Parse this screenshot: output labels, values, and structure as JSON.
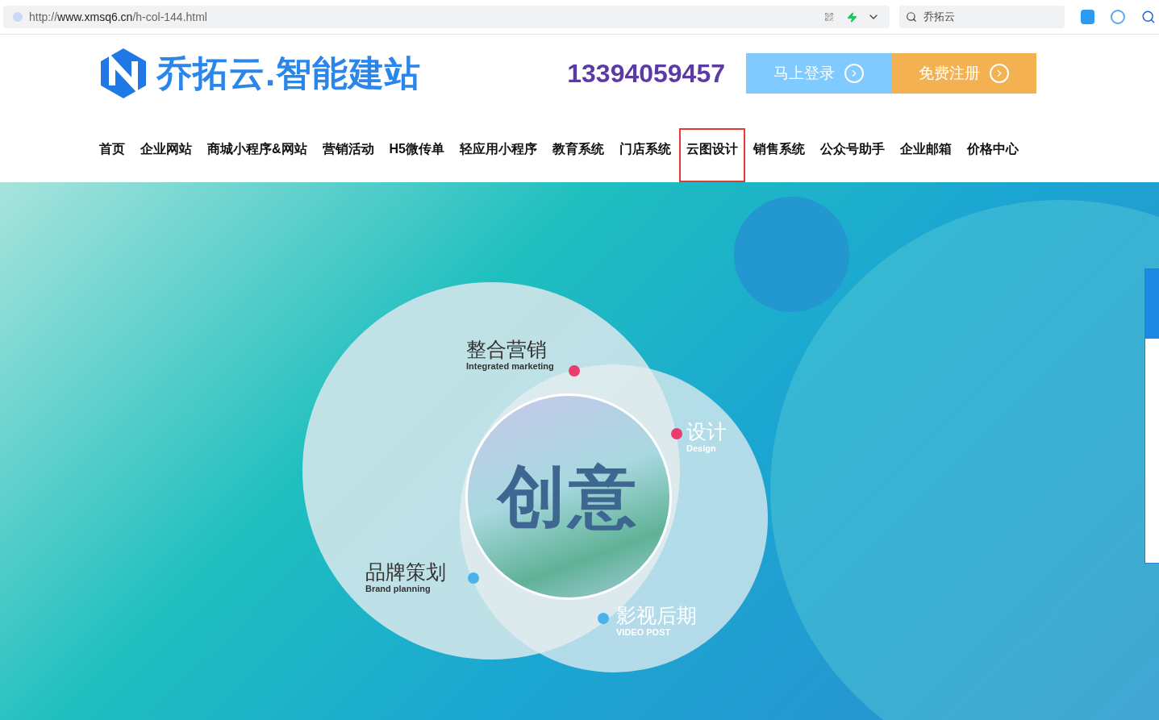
{
  "browser": {
    "url_prefix": "http://",
    "url_host": "www.xmsq6.cn",
    "url_path": "/h-col-144.html",
    "search_value": "乔拓云"
  },
  "header": {
    "logo_text": "乔拓云.智能建站",
    "phone": "13394059457",
    "buttons": [
      {
        "label": "马上登录",
        "kind": "login"
      },
      {
        "label": "免费注册",
        "kind": "register"
      }
    ]
  },
  "nav": [
    {
      "label": "首页",
      "selected": false
    },
    {
      "label": "企业网站",
      "selected": false
    },
    {
      "label": "商城小程序&网站",
      "selected": false
    },
    {
      "label": "营销活动",
      "selected": false
    },
    {
      "label": "H5微传单",
      "selected": false
    },
    {
      "label": "轻应用小程序",
      "selected": false
    },
    {
      "label": "教育系统",
      "selected": false
    },
    {
      "label": "门店系统",
      "selected": false
    },
    {
      "label": "云图设计",
      "selected": true
    },
    {
      "label": "销售系统",
      "selected": false
    },
    {
      "label": "公众号助手",
      "selected": false
    },
    {
      "label": "企业邮箱",
      "selected": false
    },
    {
      "label": "价格中心",
      "selected": false
    }
  ],
  "hero": {
    "center_text": "创意",
    "labels": [
      {
        "title": "整合营销",
        "subtitle": "Integrated marketing",
        "color": "#e83e6b"
      },
      {
        "title": "设计",
        "subtitle": "Design",
        "color": "#e83e6b"
      },
      {
        "title": "品牌策划",
        "subtitle": "Brand planning",
        "color": "#4ab3ef"
      },
      {
        "title": "影视后期",
        "subtitle": "VIDEO POST",
        "color": "#4ab3ef"
      }
    ]
  }
}
